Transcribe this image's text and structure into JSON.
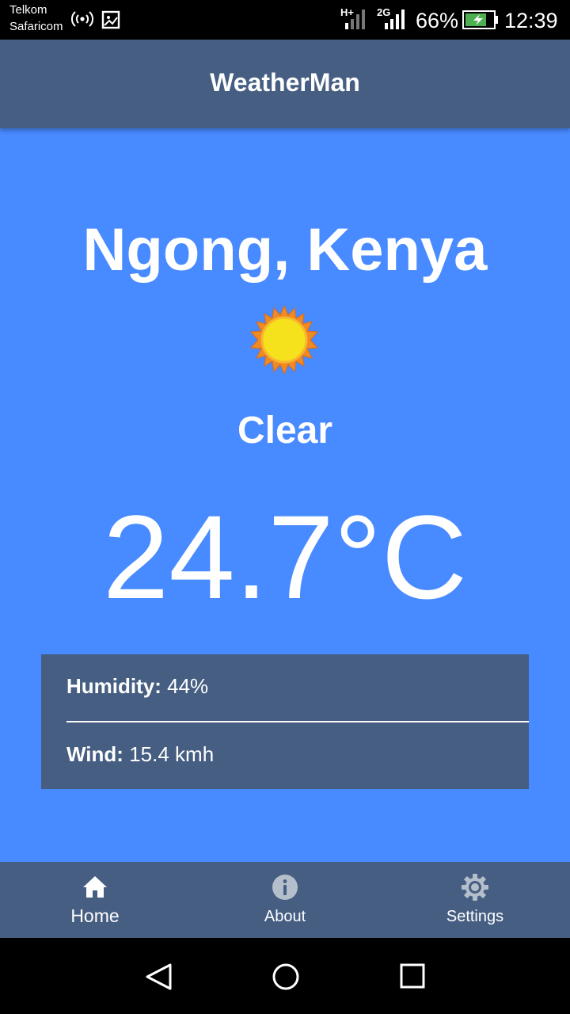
{
  "status_bar": {
    "carrier_1": "Telkom",
    "carrier_2": "Safaricom",
    "network_1": "H+",
    "network_2": "2G",
    "battery_percent": "66%",
    "time": "12:39",
    "icons": [
      "hotspot-icon",
      "image-icon",
      "signal-icon",
      "battery-charging-icon"
    ]
  },
  "app_bar": {
    "title": "WeatherMan"
  },
  "weather": {
    "location": "Ngong, Kenya",
    "condition": "Clear",
    "temperature": "24.7°C",
    "icon": "sun-icon"
  },
  "details": {
    "humidity_label": "Humidity:",
    "humidity_value": "44%",
    "wind_label": "Wind:",
    "wind_value": "15.4 kmh"
  },
  "tabs": [
    {
      "label": "Home",
      "icon": "home-icon",
      "active": true
    },
    {
      "label": "About",
      "icon": "info-icon",
      "active": false
    },
    {
      "label": "Settings",
      "icon": "gear-icon",
      "active": false
    }
  ],
  "colors": {
    "primary": "#455e82",
    "content_background": "#488aff",
    "text": "#ffffff",
    "inactive_tab_icon": "#b5bfcc",
    "sun_fill": "#f5e21c",
    "sun_edge": "#f08a24"
  }
}
